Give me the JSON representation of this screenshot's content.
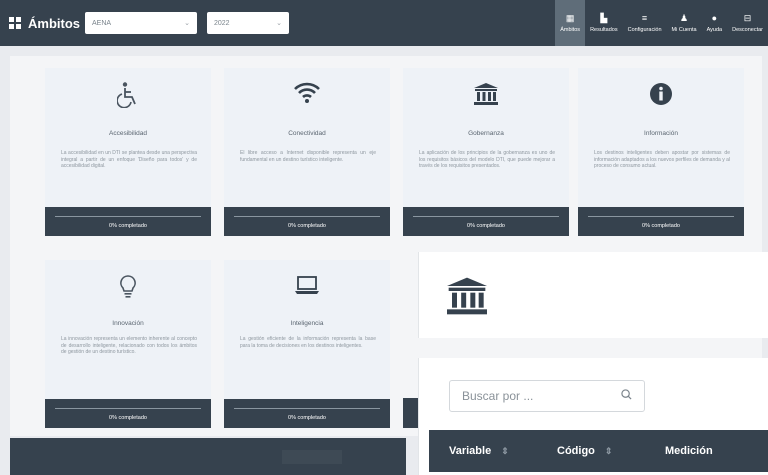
{
  "header": {
    "title": "Ámbitos",
    "select_1": "AENA",
    "select_2": "2022",
    "nav": [
      {
        "label": "Ámbitos",
        "icon": "grid-icon",
        "glyph": "▦",
        "active": true
      },
      {
        "label": "Resultados",
        "icon": "bar-chart-icon",
        "glyph": "▙",
        "active": false
      },
      {
        "label": "Configuración",
        "icon": "sliders-icon",
        "glyph": "≡",
        "active": false
      },
      {
        "label": "Mi Cuenta",
        "icon": "user-icon",
        "glyph": "♟",
        "active": false
      },
      {
        "label": "Ayuda",
        "icon": "help-icon",
        "glyph": "●",
        "active": false
      },
      {
        "label": "Desconectar",
        "icon": "logout-icon",
        "glyph": "⊟",
        "active": false
      }
    ]
  },
  "cards": [
    {
      "title": "Accesibilidad",
      "icon": "wheelchair-icon",
      "glyph": "♿",
      "desc": "La accesibilidad en un DTI se plantea desde una perspectiva integral a partir de un enfoque 'Diseño para todos' y de accesibilidad digital.",
      "status": "0% completado"
    },
    {
      "title": "Conectividad",
      "icon": "wifi-icon",
      "glyph": "",
      "desc": "El libre acceso a Internet disponible representa un eje fundamental en un destino turístico inteligente.",
      "status": "0% completado"
    },
    {
      "title": "Gobernanza",
      "icon": "institution-icon",
      "glyph": "🏛",
      "desc": "La aplicación de los principios de la gobernanza es uno de los requisitos básicos del modelo DTI, que puede mejorar a través de los requisitos presentados.",
      "status": "0% completado"
    },
    {
      "title": "Información",
      "icon": "info-icon",
      "glyph": "i",
      "desc": "Los destinos inteligentes deben apostar por sistemas de información adaptados a los nuevos perfiles de demanda y al proceso de consumo actual.",
      "status": "0% completado"
    },
    {
      "title": "Innovación",
      "icon": "lightbulb-icon",
      "glyph": "",
      "desc": "La innovación representa un elemento inherente al concepto de desarrollo inteligente, relacionado con todos los ámbitos de gestión de un destino turístico.",
      "status": "0% completado"
    },
    {
      "title": "Inteligencia",
      "icon": "laptop-icon",
      "glyph": "",
      "desc": "La gestión eficiente de la información representa la base para la toma de decisiones en los destinos inteligentes.",
      "status": "0% completado"
    }
  ],
  "panel": {
    "icon": "institution-icon",
    "search_placeholder": "Buscar por ...",
    "columns": [
      "Variable",
      "Código",
      "Medición"
    ]
  }
}
